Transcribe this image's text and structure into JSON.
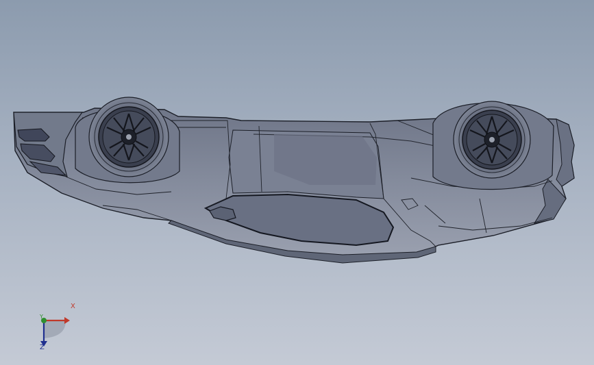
{
  "viewport": {
    "background_top": "#8c9bae",
    "background_bottom": "#c4cad5",
    "model_color": "#7c8394",
    "edge_color": "#1b1e27"
  },
  "model": {
    "name": "car-body-upside-down",
    "view": "side"
  },
  "triad": {
    "x_label": "X",
    "y_label": "Y",
    "z_label": "Z",
    "x_color": "#c0392b",
    "y_color": "#2f8f2f",
    "z_color": "#1f2f8f"
  }
}
